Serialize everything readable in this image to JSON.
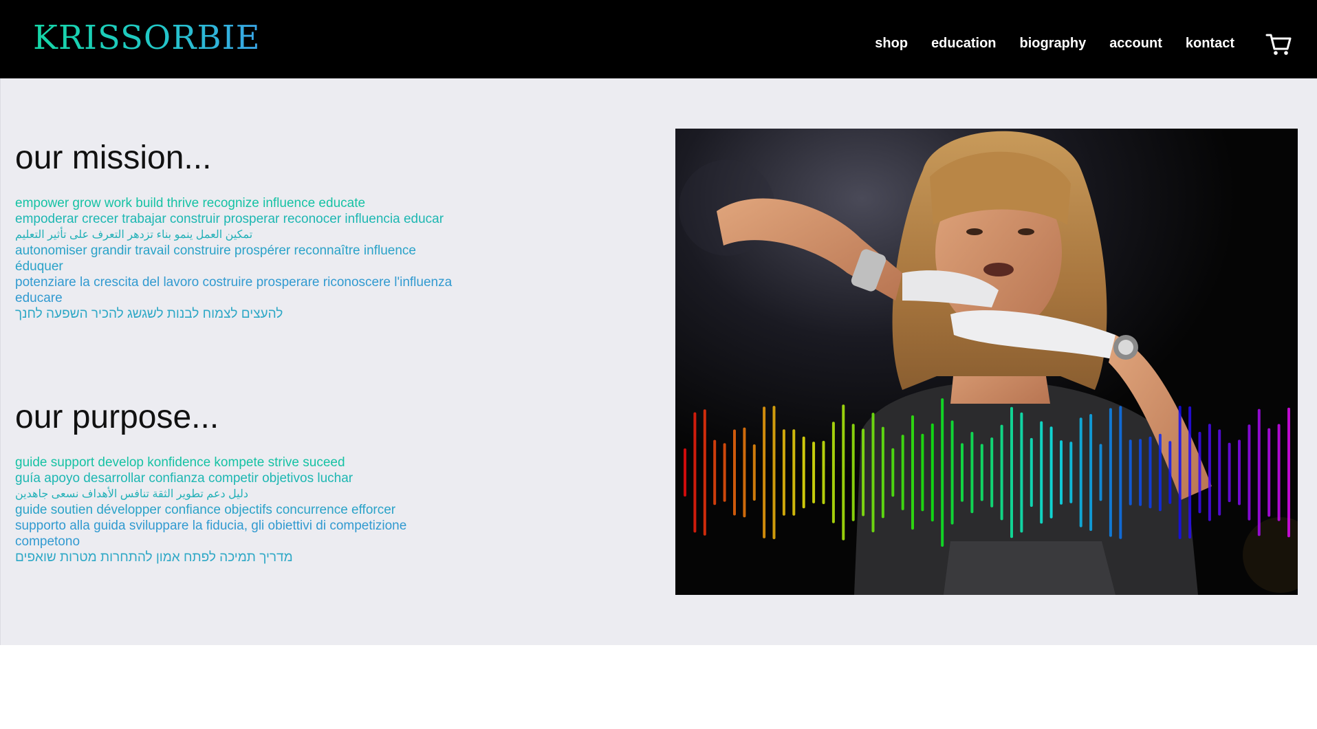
{
  "header": {
    "logo": "KRISSORBIE",
    "nav": [
      "shop",
      "education",
      "biography",
      "account",
      "kontact"
    ],
    "cart_icon": "shopping-cart-icon"
  },
  "mission": {
    "heading": "our mission...",
    "lines": [
      "empower grow work build thrive recognize influence educate",
      "empoderar crecer trabajar construir prosperar reconocer influencia educar",
      "تمكين العمل ينمو بناء تزدهر التعرف على تأثير التعليم",
      "autonomiser grandir travail construire prospérer reconnaître influence éduquer",
      "potenziare la crescita del lavoro costruire prosperare riconoscere l'influenza educare",
      "להעצים לצמוח לבנות לשגשג להכיר השפעה לחנך"
    ]
  },
  "purpose": {
    "heading": "our purpose...",
    "lines": [
      "guide support develop konfidence kompete strive suceed",
      "guía apoyo desarrollar confianza competir objetivos luchar",
      "دليل دعم تطوير  الثقة تنافس الأهداف نسعى جاهدين",
      "guide soutien développer confiance objectifs concurrence efforcer",
      "supporto alla guida sviluppare la fiducia, gli obiettivi di competizione competono",
      "מדריך תמיכה לפתח אמון להתחרות מטרות שואפים"
    ]
  },
  "colors": {
    "header_bg": "#000000",
    "content_bg": "#ececf1",
    "accent_teal": "#1bb6a4",
    "accent_blue": "#319ad0"
  }
}
